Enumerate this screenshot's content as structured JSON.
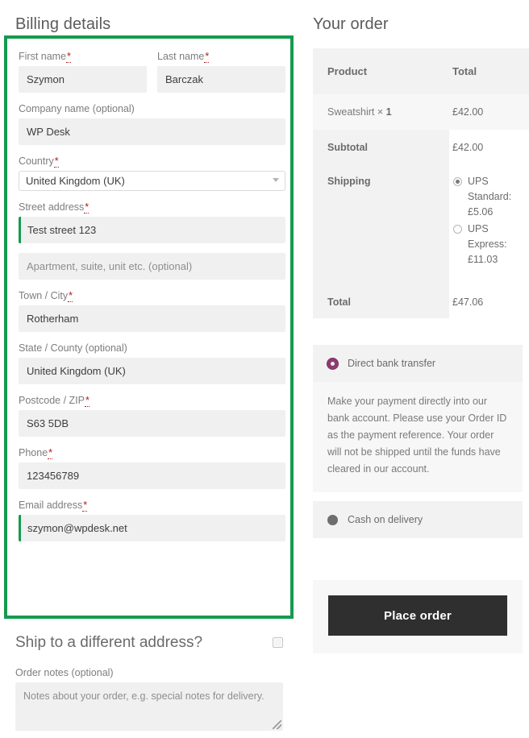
{
  "billing": {
    "title": "Billing details",
    "required_marker": "*",
    "fields": [
      {
        "name": "first_name",
        "label": "First name",
        "required": true,
        "value": "Szymon",
        "placeholder": ""
      },
      {
        "name": "last_name",
        "label": "Last name",
        "required": true,
        "value": "Barczak",
        "placeholder": ""
      },
      {
        "name": "company",
        "label": "Company name (optional)",
        "required": false,
        "value": "WP Desk",
        "placeholder": ""
      },
      {
        "name": "country",
        "label": "Country",
        "required": true,
        "value": "United Kingdom (UK)",
        "placeholder": ""
      },
      {
        "name": "address_1",
        "label": "Street address",
        "required": true,
        "value": "Test street 123",
        "placeholder": ""
      },
      {
        "name": "address_2",
        "label": "",
        "required": false,
        "value": "",
        "placeholder": "Apartment, suite, unit etc. (optional)"
      },
      {
        "name": "city",
        "label": "Town / City",
        "required": true,
        "value": "Rotherham",
        "placeholder": ""
      },
      {
        "name": "state",
        "label": "State / County (optional)",
        "required": false,
        "value": "United Kingdom (UK)",
        "placeholder": ""
      },
      {
        "name": "postcode",
        "label": "Postcode / ZIP",
        "required": true,
        "value": "S63 5DB",
        "placeholder": ""
      },
      {
        "name": "phone",
        "label": "Phone",
        "required": true,
        "value": "123456789",
        "placeholder": ""
      },
      {
        "name": "email",
        "label": "Email address",
        "required": true,
        "value": "szymon@wpdesk.net",
        "placeholder": ""
      }
    ],
    "validation_frame_color": "#159b4e"
  },
  "shipping_section": {
    "title": "Ship to a different address?",
    "checkbox_checked": false,
    "notes_label": "Order notes (optional)",
    "notes_value": "",
    "notes_placeholder": "Notes about your order, e.g. special notes for delivery."
  },
  "order": {
    "title": "Your order",
    "columns": [
      "Product",
      "Total"
    ],
    "items": [
      {
        "name": "Sweatshirt",
        "qty_separator": "×",
        "qty": "1",
        "total": "£42.00"
      }
    ],
    "subtotal_label": "Subtotal",
    "subtotal_value": "£42.00",
    "shipping_label": "Shipping",
    "shipping_options": [
      {
        "label": "UPS Standard:",
        "price": "£5.06",
        "selected": true
      },
      {
        "label": "UPS Express:",
        "price": "£11.03",
        "selected": false
      }
    ],
    "total_label": "Total",
    "total_value": "£47.06"
  },
  "payment": {
    "methods": [
      {
        "id": "bacs",
        "label": "Direct bank transfer",
        "selected": true,
        "accent": "#8e3b72"
      },
      {
        "id": "cod",
        "label": "Cash on delivery",
        "selected": false,
        "accent": "#6e6e6e"
      }
    ],
    "description": "Make your payment directly into our bank account. Please use your Order ID as the payment reference. Your order will not be shipped until the funds have cleared in our account.",
    "place_order_label": "Place order",
    "place_order_bg": "#2f2f2f"
  }
}
